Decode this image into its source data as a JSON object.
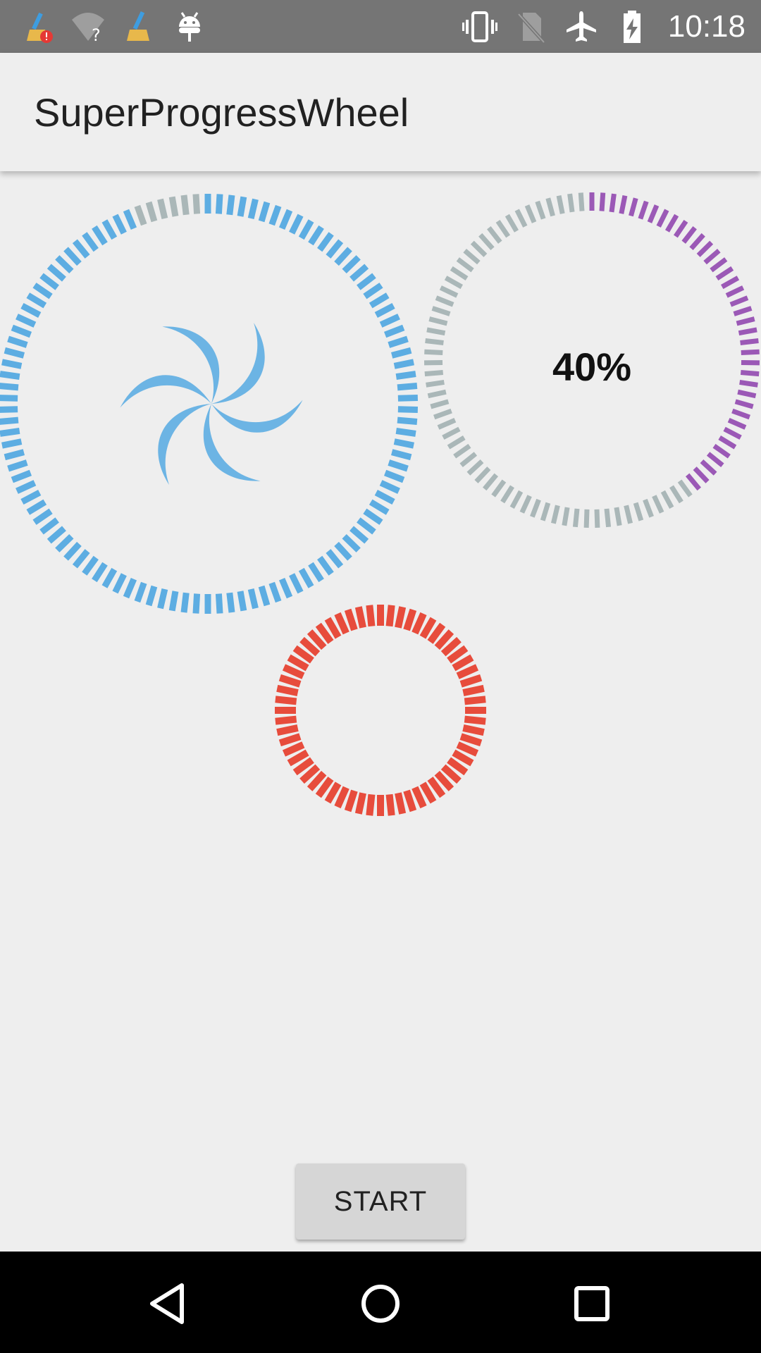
{
  "status_bar": {
    "time": "10:18",
    "left_icons": [
      "cleaner-alert-icon",
      "wifi-question-icon",
      "cleaner-icon",
      "android-debug-icon"
    ],
    "right_icons": [
      "vibrate-icon",
      "no-sim-icon",
      "airplane-mode-icon",
      "battery-charging-icon"
    ]
  },
  "app_bar": {
    "title": "SuperProgressWheel"
  },
  "wheels": [
    {
      "name": "large-wheel",
      "color": "#5dade2",
      "track_color": "#aab7b8",
      "progress": 0.94,
      "center_icon": "pinwheel-icon"
    },
    {
      "name": "percent-wheel",
      "color": "#9b59b6",
      "track_color": "#aab7b8",
      "progress": 0.4,
      "label": "40%"
    },
    {
      "name": "small-wheel",
      "color": "#e74c3c",
      "track_color": "#aab7b8",
      "progress": 1.0
    }
  ],
  "start_button": {
    "label": "START"
  },
  "nav_bar": {
    "icons": [
      "back-icon",
      "home-icon",
      "recents-icon"
    ]
  }
}
